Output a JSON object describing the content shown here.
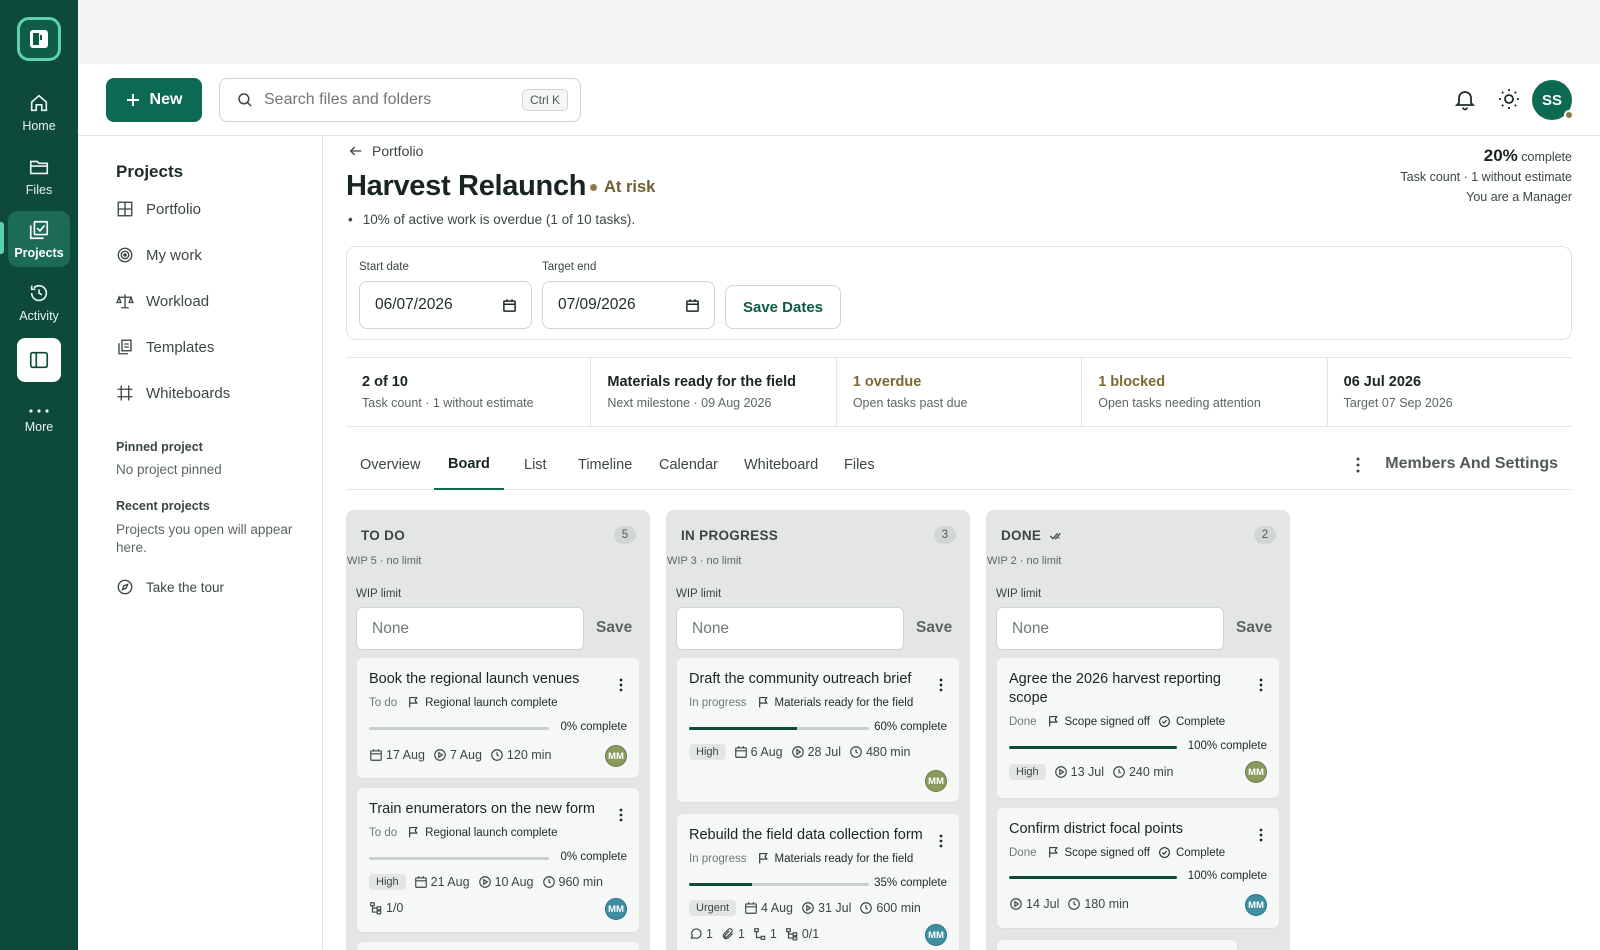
{
  "rail": {
    "items": [
      {
        "label": "Home"
      },
      {
        "label": "Files"
      },
      {
        "label": "Projects"
      },
      {
        "label": "Activity"
      },
      {
        "label": "More"
      }
    ]
  },
  "topbar": {
    "new_label": "New",
    "search_placeholder": "Search files and folders",
    "search_shortcut": "Ctrl K",
    "avatar_initials": "SS"
  },
  "sidebar": {
    "title": "Projects",
    "items": [
      {
        "label": "Portfolio"
      },
      {
        "label": "My work"
      },
      {
        "label": "Workload"
      },
      {
        "label": "Templates"
      },
      {
        "label": "Whiteboards"
      }
    ],
    "pinned_label": "Pinned project",
    "pinned_value": "No project pinned",
    "recent_label": "Recent projects",
    "recent_value": "Projects you open will appear here.",
    "tour_label": "Take the tour"
  },
  "project": {
    "breadcrumb": "Portfolio",
    "title": "Harvest Relaunch",
    "status": "At risk",
    "note": "10% of active work is overdue (1 of 10 tasks).",
    "summary": {
      "pct": "20%",
      "pct_suffix": "complete",
      "line1": "Task count · 1 without estimate",
      "line2": "You are a Manager"
    },
    "dates": {
      "start_label": "Start date",
      "start_value": "06/07/2026",
      "end_label": "Target end",
      "end_value": "07/09/2026",
      "save_label": "Save Dates"
    },
    "stats": [
      {
        "value": "2 of 10",
        "sub": "Task count · 1 without estimate"
      },
      {
        "value": "Materials ready for the field",
        "sub": "Next milestone · 09 Aug 2026"
      },
      {
        "value": "1 overdue",
        "sub": "Open tasks past due"
      },
      {
        "value": "1 blocked",
        "sub": "Open tasks needing attention"
      },
      {
        "value": "06 Jul 2026",
        "sub": "Target 07 Sep 2026"
      }
    ],
    "tabs": [
      {
        "label": "Overview"
      },
      {
        "label": "Board"
      },
      {
        "label": "List"
      },
      {
        "label": "Timeline"
      },
      {
        "label": "Calendar"
      },
      {
        "label": "Whiteboard"
      },
      {
        "label": "Files"
      }
    ],
    "members_label": "Members And Settings"
  },
  "board": {
    "columns": [
      {
        "title": "TO DO",
        "count": "5",
        "wip": "WIP 5 · no limit",
        "wip_label": "WIP limit",
        "wip_placeholder": "None",
        "save": "Save",
        "cards": [
          {
            "title": "Book the regional launch venues",
            "status": "To do",
            "milestone": "Regional launch complete",
            "progress": 0,
            "pct": "0% complete",
            "due": "17 Aug",
            "start": "7 Aug",
            "est": "120 min",
            "avatar": "MM"
          },
          {
            "title": "Train enumerators on the new form",
            "status": "To do",
            "milestone": "Regional launch complete",
            "progress": 0,
            "pct": "0% complete",
            "priority": "High",
            "due": "21 Aug",
            "start": "10 Aug",
            "est": "960 min",
            "subtasks": "1/0",
            "avatar": "MM"
          }
        ]
      },
      {
        "title": "IN PROGRESS",
        "count": "3",
        "wip": "WIP 3 · no limit",
        "wip_label": "WIP limit",
        "wip_placeholder": "None",
        "save": "Save",
        "cards": [
          {
            "title": "Draft the community outreach brief",
            "status": "In progress",
            "milestone": "Materials ready for the field",
            "progress": 60,
            "pct": "60% complete",
            "priority": "High",
            "due": "6 Aug",
            "start": "28 Jul",
            "est": "480 min",
            "avatar": "MM"
          },
          {
            "title": "Rebuild the field data collection form",
            "status": "In progress",
            "milestone": "Materials ready for the field",
            "progress": 35,
            "pct": "35% complete",
            "priority": "Urgent",
            "due": "4 Aug",
            "start": "31 Jul",
            "est": "600 min",
            "comments": "1",
            "attachments": "1",
            "deps": "1",
            "subtasks": "0/1",
            "avatar": "MM"
          }
        ]
      },
      {
        "title": "DONE",
        "count": "2",
        "wip": "WIP 2 · no limit",
        "wip_label": "WIP limit",
        "wip_placeholder": "None",
        "save": "Save",
        "cards": [
          {
            "title": "Agree the 2026 harvest reporting scope",
            "status": "Done",
            "milestone": "Scope signed off",
            "complete_label": "Complete",
            "progress": 100,
            "pct": "100% complete",
            "priority": "High",
            "start": "13 Jul",
            "est": "240 min",
            "avatar": "MM"
          },
          {
            "title": "Confirm district focal points",
            "status": "Done",
            "milestone": "Scope signed off",
            "complete_label": "Complete",
            "progress": 100,
            "pct": "100% complete",
            "start": "14 Jul",
            "est": "180 min",
            "avatar": "MM"
          }
        ]
      }
    ]
  },
  "colors": {
    "brand": "#0d4a3c",
    "accent": "#0d6a52",
    "warning": "#7a6a30"
  }
}
